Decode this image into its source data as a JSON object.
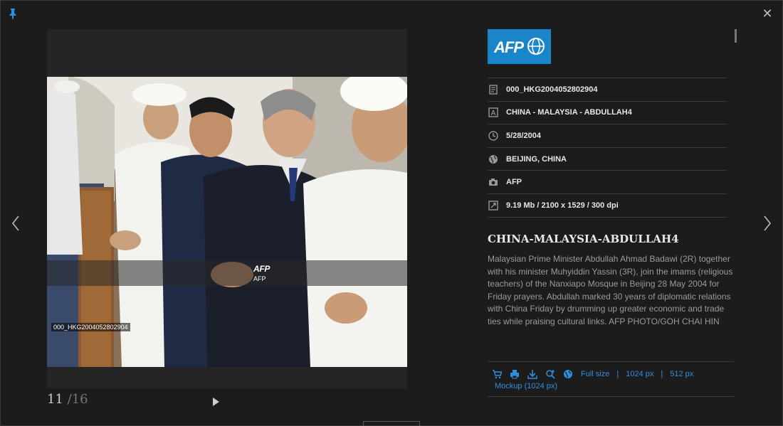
{
  "viewer": {
    "counter_current": "11",
    "counter_total": "/16",
    "photo_id_overlay": "000_HKG2004052802904",
    "watermark_logo": "AFP",
    "watermark_text": "AFP"
  },
  "panel": {
    "logo_text": "AFP",
    "meta": {
      "id": "000_HKG2004052802904",
      "title": "CHINA - MALAYSIA - ABDULLAH4",
      "date": "5/28/2004",
      "location": "BEIJING, CHINA",
      "credit": "AFP",
      "size": "9.19 Mb / 2100 x 1529 / 300 dpi"
    },
    "headline": "CHINA-MALAYSIA-ABDULLAH4",
    "caption": "Malaysian Prime Minister Abdullah Ahmad Badawi (2R) together with his minister Muhyiddin Yassin (3R), join the imams (religious teachers) of the Nanxiapo Mosque in Beijing 28 May 2004 for Friday prayers. Abdullah marked 30 years of diplomatic relations with China Friday by drumming up greater economic and trade ties while praising cultural links. AFP PHOTO/GOH CHAI HIN"
  },
  "downloads": {
    "full_size": "Full size",
    "sep": "|",
    "px1024": "1024 px",
    "px512": "512 px",
    "mockup": "Mockup (1024 px)"
  },
  "colors": {
    "accent": "#2f8fdf",
    "afp_blue": "#1a86c9",
    "background": "#1c1c1c"
  },
  "icons": [
    "pin-icon",
    "close-icon",
    "chevron-left-icon",
    "chevron-right-icon",
    "play-icon",
    "document-icon",
    "title-icon",
    "clock-icon",
    "globe-icon",
    "camera-icon",
    "resize-icon",
    "cart-icon",
    "print-icon",
    "download-icon",
    "zoom-in-icon",
    "globe-link-icon"
  ]
}
